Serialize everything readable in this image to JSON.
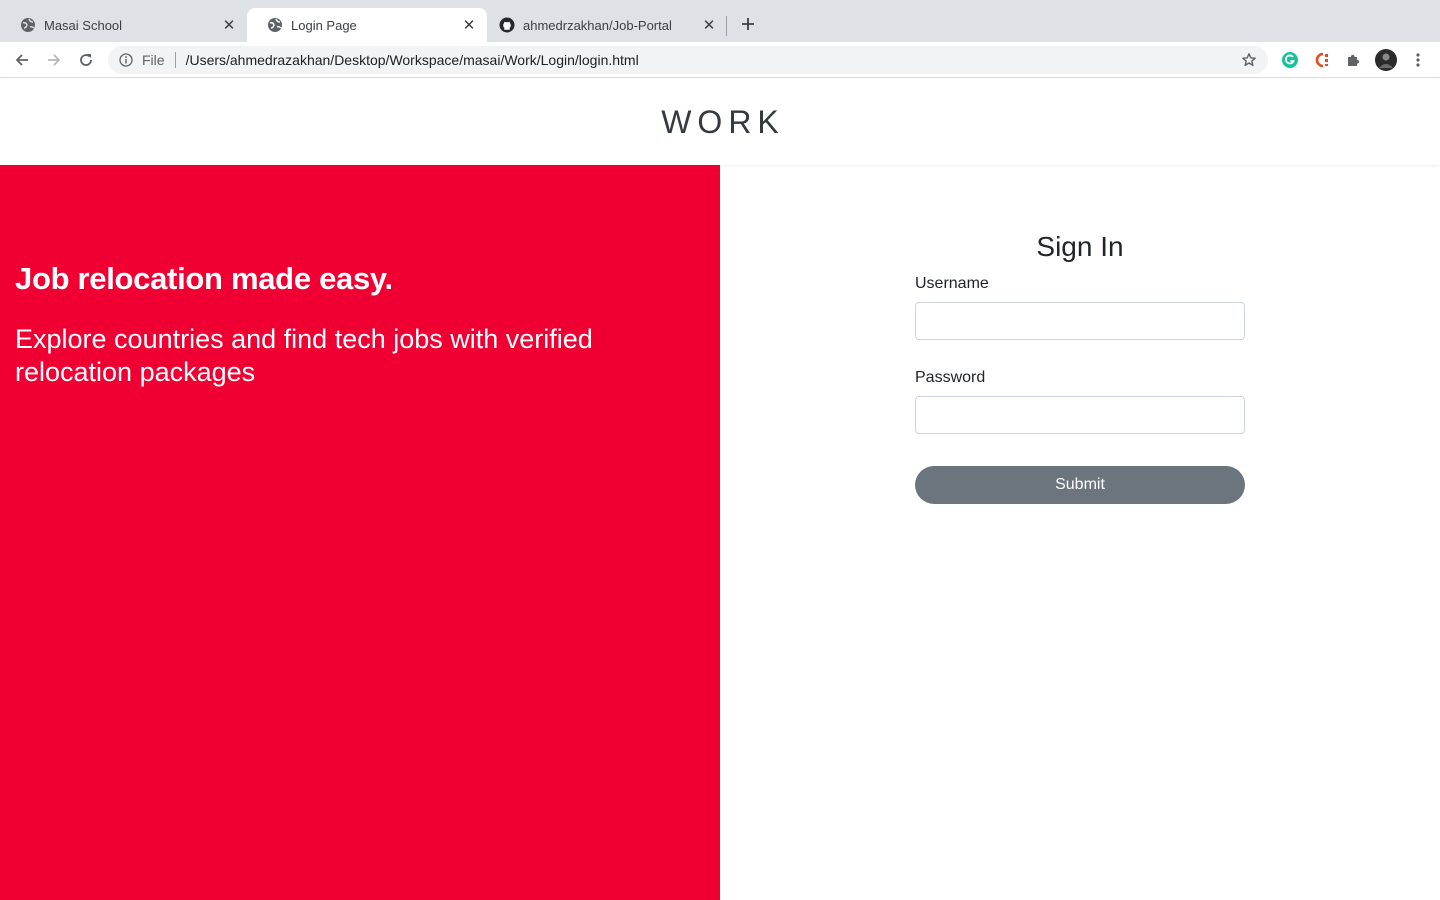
{
  "browser": {
    "tabs": [
      {
        "title": "Masai School",
        "icon": "globe-icon",
        "active": false
      },
      {
        "title": "Login Page",
        "icon": "globe-icon",
        "active": true
      },
      {
        "title": "ahmedrzakhan/Job-Portal",
        "icon": "github-icon",
        "active": false
      }
    ],
    "address": {
      "scheme": "File",
      "url": "/Users/ahmedrazakhan/Desktop/Workspace/masai/Work/Login/login.html"
    },
    "extensions": [
      "grammarly-icon",
      "colorpick-icon",
      "puzzle-icon",
      "profile-avatar",
      "more-vert-icon"
    ]
  },
  "header": {
    "brand": "WORK"
  },
  "hero": {
    "title": "Job relocation made easy.",
    "subtitle": "Explore countries and find tech jobs with verified relocation packages",
    "background": "#f00032"
  },
  "signin": {
    "title": "Sign In",
    "username_label": "Username",
    "username_value": "",
    "password_label": "Password",
    "password_value": "",
    "submit_label": "Submit",
    "button_color": "#6c757d"
  }
}
